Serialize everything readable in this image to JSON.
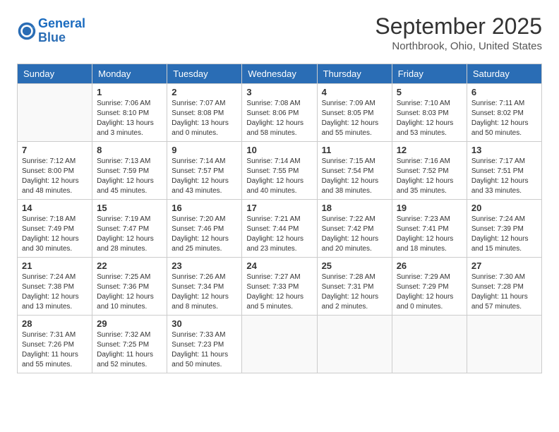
{
  "header": {
    "logo_line1": "General",
    "logo_line2": "Blue",
    "month": "September 2025",
    "location": "Northbrook, Ohio, United States"
  },
  "weekdays": [
    "Sunday",
    "Monday",
    "Tuesday",
    "Wednesday",
    "Thursday",
    "Friday",
    "Saturday"
  ],
  "weeks": [
    [
      {
        "day": "",
        "info": ""
      },
      {
        "day": "1",
        "info": "Sunrise: 7:06 AM\nSunset: 8:10 PM\nDaylight: 13 hours\nand 3 minutes."
      },
      {
        "day": "2",
        "info": "Sunrise: 7:07 AM\nSunset: 8:08 PM\nDaylight: 13 hours\nand 0 minutes."
      },
      {
        "day": "3",
        "info": "Sunrise: 7:08 AM\nSunset: 8:06 PM\nDaylight: 12 hours\nand 58 minutes."
      },
      {
        "day": "4",
        "info": "Sunrise: 7:09 AM\nSunset: 8:05 PM\nDaylight: 12 hours\nand 55 minutes."
      },
      {
        "day": "5",
        "info": "Sunrise: 7:10 AM\nSunset: 8:03 PM\nDaylight: 12 hours\nand 53 minutes."
      },
      {
        "day": "6",
        "info": "Sunrise: 7:11 AM\nSunset: 8:02 PM\nDaylight: 12 hours\nand 50 minutes."
      }
    ],
    [
      {
        "day": "7",
        "info": "Sunrise: 7:12 AM\nSunset: 8:00 PM\nDaylight: 12 hours\nand 48 minutes."
      },
      {
        "day": "8",
        "info": "Sunrise: 7:13 AM\nSunset: 7:59 PM\nDaylight: 12 hours\nand 45 minutes."
      },
      {
        "day": "9",
        "info": "Sunrise: 7:14 AM\nSunset: 7:57 PM\nDaylight: 12 hours\nand 43 minutes."
      },
      {
        "day": "10",
        "info": "Sunrise: 7:14 AM\nSunset: 7:55 PM\nDaylight: 12 hours\nand 40 minutes."
      },
      {
        "day": "11",
        "info": "Sunrise: 7:15 AM\nSunset: 7:54 PM\nDaylight: 12 hours\nand 38 minutes."
      },
      {
        "day": "12",
        "info": "Sunrise: 7:16 AM\nSunset: 7:52 PM\nDaylight: 12 hours\nand 35 minutes."
      },
      {
        "day": "13",
        "info": "Sunrise: 7:17 AM\nSunset: 7:51 PM\nDaylight: 12 hours\nand 33 minutes."
      }
    ],
    [
      {
        "day": "14",
        "info": "Sunrise: 7:18 AM\nSunset: 7:49 PM\nDaylight: 12 hours\nand 30 minutes."
      },
      {
        "day": "15",
        "info": "Sunrise: 7:19 AM\nSunset: 7:47 PM\nDaylight: 12 hours\nand 28 minutes."
      },
      {
        "day": "16",
        "info": "Sunrise: 7:20 AM\nSunset: 7:46 PM\nDaylight: 12 hours\nand 25 minutes."
      },
      {
        "day": "17",
        "info": "Sunrise: 7:21 AM\nSunset: 7:44 PM\nDaylight: 12 hours\nand 23 minutes."
      },
      {
        "day": "18",
        "info": "Sunrise: 7:22 AM\nSunset: 7:42 PM\nDaylight: 12 hours\nand 20 minutes."
      },
      {
        "day": "19",
        "info": "Sunrise: 7:23 AM\nSunset: 7:41 PM\nDaylight: 12 hours\nand 18 minutes."
      },
      {
        "day": "20",
        "info": "Sunrise: 7:24 AM\nSunset: 7:39 PM\nDaylight: 12 hours\nand 15 minutes."
      }
    ],
    [
      {
        "day": "21",
        "info": "Sunrise: 7:24 AM\nSunset: 7:38 PM\nDaylight: 12 hours\nand 13 minutes."
      },
      {
        "day": "22",
        "info": "Sunrise: 7:25 AM\nSunset: 7:36 PM\nDaylight: 12 hours\nand 10 minutes."
      },
      {
        "day": "23",
        "info": "Sunrise: 7:26 AM\nSunset: 7:34 PM\nDaylight: 12 hours\nand 8 minutes."
      },
      {
        "day": "24",
        "info": "Sunrise: 7:27 AM\nSunset: 7:33 PM\nDaylight: 12 hours\nand 5 minutes."
      },
      {
        "day": "25",
        "info": "Sunrise: 7:28 AM\nSunset: 7:31 PM\nDaylight: 12 hours\nand 2 minutes."
      },
      {
        "day": "26",
        "info": "Sunrise: 7:29 AM\nSunset: 7:29 PM\nDaylight: 12 hours\nand 0 minutes."
      },
      {
        "day": "27",
        "info": "Sunrise: 7:30 AM\nSunset: 7:28 PM\nDaylight: 11 hours\nand 57 minutes."
      }
    ],
    [
      {
        "day": "28",
        "info": "Sunrise: 7:31 AM\nSunset: 7:26 PM\nDaylight: 11 hours\nand 55 minutes."
      },
      {
        "day": "29",
        "info": "Sunrise: 7:32 AM\nSunset: 7:25 PM\nDaylight: 11 hours\nand 52 minutes."
      },
      {
        "day": "30",
        "info": "Sunrise: 7:33 AM\nSunset: 7:23 PM\nDaylight: 11 hours\nand 50 minutes."
      },
      {
        "day": "",
        "info": ""
      },
      {
        "day": "",
        "info": ""
      },
      {
        "day": "",
        "info": ""
      },
      {
        "day": "",
        "info": ""
      }
    ]
  ]
}
